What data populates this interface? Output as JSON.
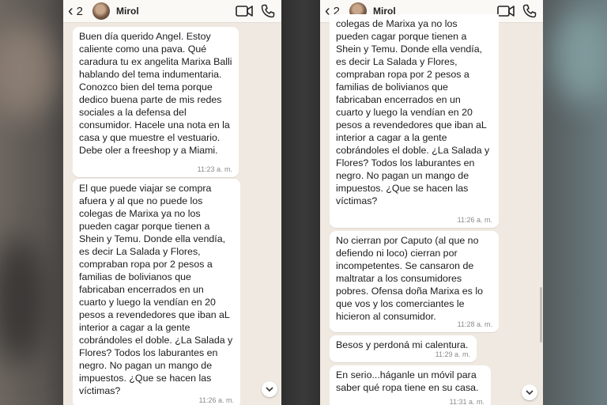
{
  "left_chat": {
    "back_count": "2",
    "contact_name": "Mirol",
    "messages": [
      {
        "text": "Buen día querido Angel. Estoy\ncaliente como una pava. Qué\ncaradura tu ex angelita Marixa Balli\nhablando del tema indumentaria.\nConozco bien del tema porque\ndedico buena parte de mis redes\nsociales a la defensa del\nconsumidor. Hacele una nota en la\ncasa y que muestre el vestuario.\nDebe oler a freeshop y a Miami.",
        "time": "11:23 a. m."
      },
      {
        "text": "El que puede viajar se compra\nafuera y al que no puede los\ncolegas de Marixa ya no los\npueden cagar porque tienen a\nShein y Temu. Donde ella vendía,\nes decir La Salada y Flores,\ncompraban ropa por 2 pesos a\nfamilias de bolivianos que\nfabricaban encerrados en un\ncuarto y luego la vendían en 20\npesos a revendedores que iban aL\ninterior a cagar a la gente\ncobrándoles el doble. ¿La Salada y\nFlores? Todos los laburantes en\nnegro. No pagan un mango de\nimpuestos. ¿Que se hacen las\nvíctimas?",
        "time": "11:26 a. m."
      }
    ]
  },
  "right_chat": {
    "back_count": "2",
    "contact_name": "Mirol",
    "messages": [
      {
        "text": "colegas de Marixa ya no los\npueden cagar porque tienen a\nShein y Temu. Donde ella vendía,\nes decir La Salada y Flores,\ncompraban ropa por 2 pesos a\nfamilias de bolivianos que\nfabricaban encerrados en un\ncuarto y luego la vendían en 20\npesos a revendedores que iban aL\ninterior a cagar a la gente\ncobrándoles el doble. ¿La Salada y\nFlores? Todos los laburantes en\nnegro. No pagan un mango de\nimpuestos. ¿Que se hacen las\nvíctimas?",
        "time": "11:26 a. m."
      },
      {
        "text": "No cierran por Caputo (al que no\ndefiendo ni loco) cierran por\nincompetentes. Se cansaron de\nmaltratar a los consumidores\npobres. Ofensa doña Marixa es lo\nque vos y los comerciantes le\nhicieron al consumidor.",
        "time": "11:28 a. m."
      },
      {
        "text": "Besos y perdoná mi calentura.",
        "time": "11:29 a. m."
      },
      {
        "text": "En serio...háganle un móvil para\nsaber qué ropa tiene en su casa.",
        "time": "11:31 a. m."
      }
    ]
  },
  "icons": {
    "back": "chevron-left-icon",
    "video": "video-camera-icon",
    "call": "phone-icon",
    "scroll": "chevron-down-icon"
  },
  "colors": {
    "chat_background": "#efe9e1",
    "bubble": "#ffffff",
    "header": "#fbf9f6"
  }
}
